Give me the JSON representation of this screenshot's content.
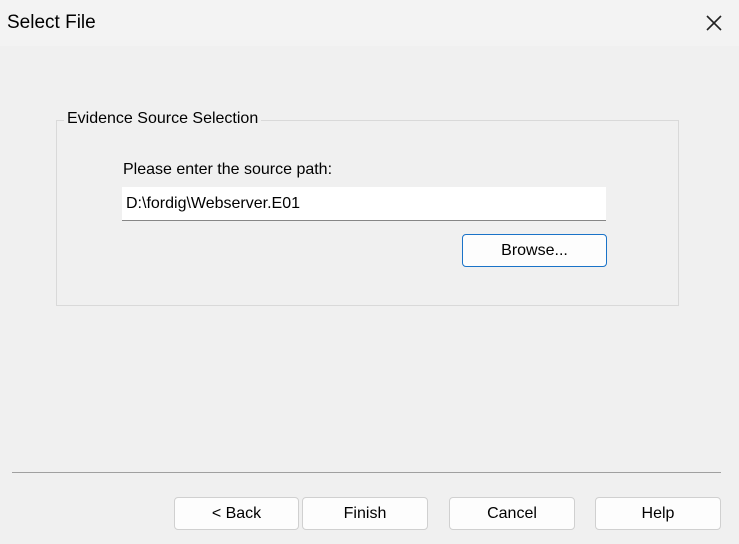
{
  "window": {
    "title": "Select File",
    "close_icon": "close-icon"
  },
  "group": {
    "legend": "Evidence Source Selection",
    "prompt": "Please enter the source path:",
    "path_value": "D:\\fordig\\Webserver.E01",
    "browse_label": "Browse..."
  },
  "footer": {
    "back_label": "< Back",
    "finish_label": "Finish",
    "cancel_label": "Cancel",
    "help_label": "Help"
  },
  "colors": {
    "background": "#f0f0f0",
    "focus_border": "#1a73c8"
  }
}
